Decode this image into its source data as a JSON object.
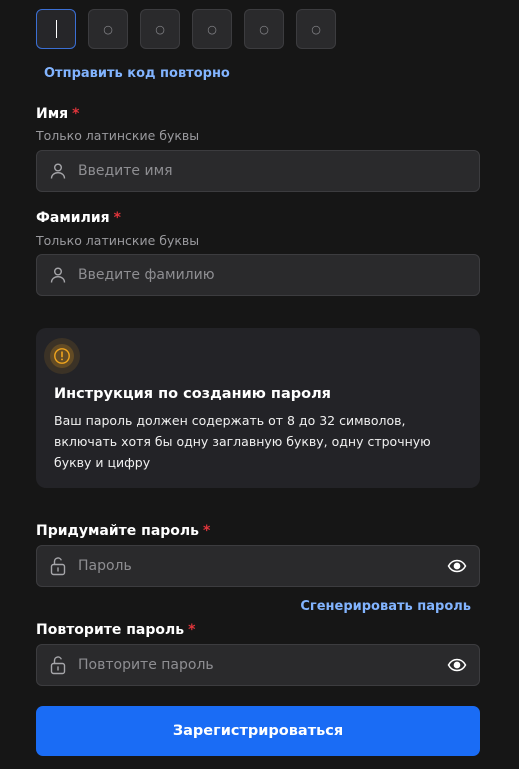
{
  "otp": {
    "cells": [
      "",
      "○",
      "○",
      "○",
      "○",
      "○"
    ]
  },
  "resend_label": "Отправить код повторно",
  "first_name": {
    "label": "Имя",
    "required_mark": "*",
    "hint": "Только латинские буквы",
    "placeholder": "Введите имя",
    "icon": "user-icon"
  },
  "last_name": {
    "label": "Фамилия",
    "required_mark": "*",
    "hint": "Только латинские буквы",
    "placeholder": "Введите фамилию",
    "icon": "user-icon"
  },
  "password_info": {
    "icon": "warning-icon",
    "title": "Инструкция по созданию пароля",
    "text": "Ваш пароль должен содержать от 8 до 32 символов, включать хотя бы одну заглавную букву, одну строчную букву и цифру"
  },
  "password": {
    "label": "Придумайте пароль",
    "required_mark": "*",
    "placeholder": "Пароль",
    "icon": "lock-icon",
    "toggle_icon": "eye-icon"
  },
  "generate_label": "Сгенерировать пароль",
  "password_repeat": {
    "label": "Повторите пароль",
    "required_mark": "*",
    "placeholder": "Повторите пароль",
    "icon": "lock-icon",
    "toggle_icon": "eye-icon"
  },
  "submit_label": "Зарегистрироваться",
  "colors": {
    "accent": "#1a6cf5",
    "link": "#82b4ff",
    "required": "#e0353b",
    "warning": "#f0a51e",
    "background": "#161616"
  }
}
